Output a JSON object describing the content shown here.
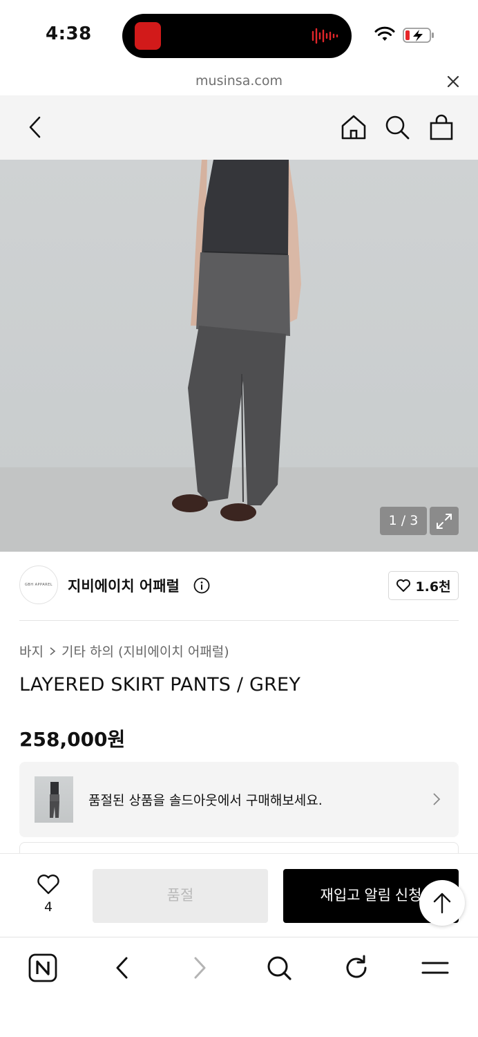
{
  "status_bar": {
    "time": "4:38",
    "battery_state": "charging-low",
    "accent_record": "#d21a1a"
  },
  "url_bar": {
    "domain": "musinsa.com",
    "close_icon": "close-icon"
  },
  "header": {
    "back_icon": "chevron-left-icon",
    "home_icon": "home-icon",
    "search_icon": "search-icon",
    "cart_icon": "shopping-bag-icon"
  },
  "gallery": {
    "counter": "1 / 3",
    "expand_icon": "expand-icon"
  },
  "brand": {
    "logo_text": "GBH APPAREL",
    "name": "지비에이치 어패럴",
    "info_icon": "info-icon",
    "likes": "1.6천"
  },
  "breadcrumb": {
    "category": "바지",
    "subcategory": "기타 하의 (지비에이치 어패럴)"
  },
  "product": {
    "title": "LAYERED SKIRT PANTS / GREY",
    "price": "258,000원"
  },
  "soldout_banner": {
    "text": "품절된 상품을 솔드아웃에서 구매해보세요."
  },
  "action_bar": {
    "wish_count": "4",
    "soldout_label": "품절",
    "restock_label": "재입고 알림 신청"
  },
  "browser_toolbar": {
    "icons": [
      "naver-icon",
      "back-icon",
      "forward-icon",
      "search-icon",
      "refresh-icon",
      "menu-icon"
    ]
  },
  "colors": {
    "header_bg": "#f4f4f4",
    "primary_button": "#000000",
    "disabled_button": "#ebebeb",
    "disabled_text": "#b9b9b9"
  }
}
